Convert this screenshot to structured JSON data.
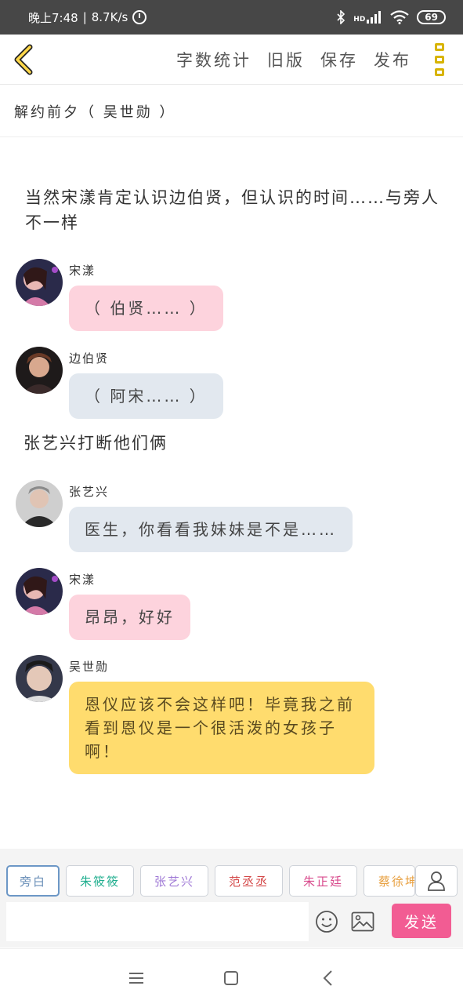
{
  "status_bar": {
    "time": "晚上7:48",
    "speed": "8.7K/s",
    "battery": "69",
    "hd": "HD"
  },
  "header": {
    "actions": [
      "字数统计",
      "旧版",
      "保存",
      "发布"
    ]
  },
  "story": {
    "title": "解约前夕（ 吴世勋 ）"
  },
  "content": {
    "narration_1": "当然宋漾肯定认识边伯贤，但认识的时间……与旁人不一样",
    "narration_2": "张艺兴打断他们俩",
    "messages": [
      {
        "speaker": "宋漾",
        "text": "（ 伯贤…… ）",
        "color": "pink"
      },
      {
        "speaker": "边伯贤",
        "text": "（ 阿宋…… ）",
        "color": "grey"
      },
      {
        "speaker": "张艺兴",
        "text": "医生，你看看我妹妹是不是……",
        "color": "grey"
      },
      {
        "speaker": "宋漾",
        "text": "昂昂，好好",
        "color": "pink"
      },
      {
        "speaker": "吴世勋",
        "text": "恩仪应该不会这样吧！毕竟我之前看到恩仪是一个很活泼的女孩子啊！",
        "color": "yellow"
      }
    ]
  },
  "characters": [
    {
      "name": "旁白",
      "color": "#6a8fb8"
    },
    {
      "name": "朱筱筱",
      "color": "#1fae8e"
    },
    {
      "name": "张艺兴",
      "color": "#a07ad6"
    },
    {
      "name": "范丞丞",
      "color": "#d44a4a"
    },
    {
      "name": "朱正廷",
      "color": "#d84a8c"
    },
    {
      "name": "蔡徐坤",
      "color": "#e8a040"
    }
  ],
  "input": {
    "placeholder": "",
    "send_label": "发送"
  },
  "colors": {
    "accent": "#f25c93",
    "back_icon": "#d8b400"
  }
}
